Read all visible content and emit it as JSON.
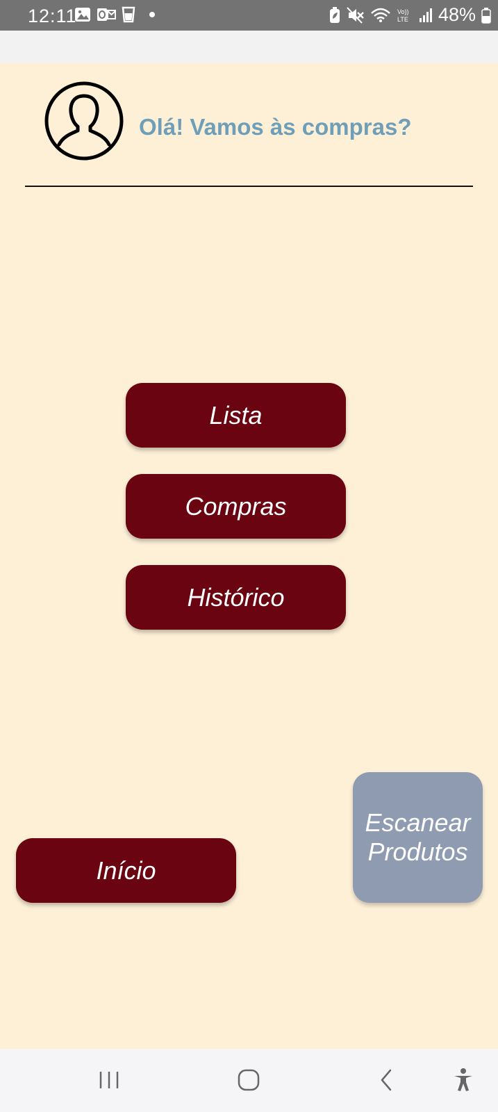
{
  "status_bar": {
    "time": "12:11",
    "battery": "48%",
    "icons": [
      "gallery-icon",
      "outlook-icon",
      "glass-icon",
      "dot-icon",
      "battery-saver-icon",
      "mute-icon",
      "wifi-icon",
      "volte-icon",
      "signal-icon",
      "battery-icon"
    ]
  },
  "header": {
    "greeting": "Olá! Vamos às compras?",
    "avatar_icon": "user-avatar-icon"
  },
  "menu": {
    "lista": "Lista",
    "compras": "Compras",
    "historico": "Histórico"
  },
  "bottom": {
    "inicio": "Início",
    "scan_line1": "Escanear",
    "scan_line2": "Produtos"
  },
  "nav_bar": {
    "icons": [
      "recent-apps-icon",
      "home-icon",
      "back-icon",
      "accessibility-icon"
    ]
  },
  "colors": {
    "background": "#fdf0d7",
    "primary_button": "#690410",
    "scan_button": "#8e9bb0",
    "greeting_text": "#6f9eb8"
  }
}
